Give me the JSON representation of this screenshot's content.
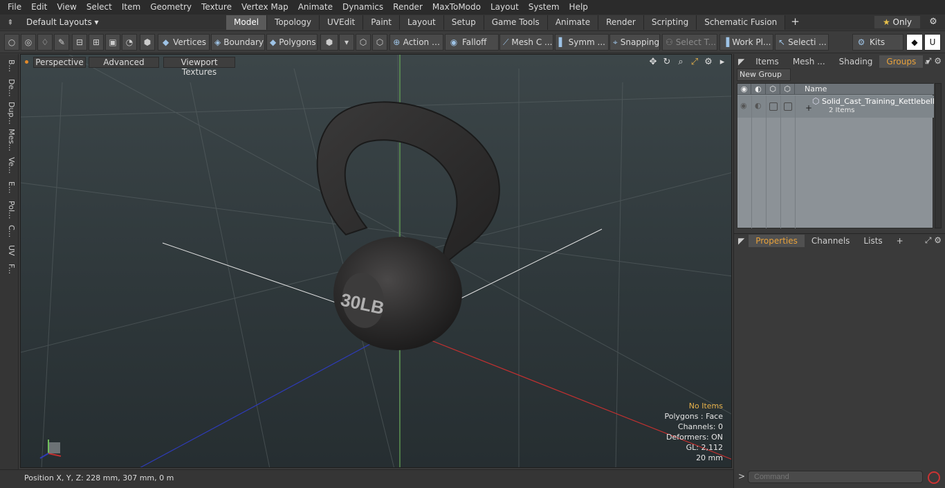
{
  "menubar": [
    "File",
    "Edit",
    "View",
    "Select",
    "Item",
    "Geometry",
    "Texture",
    "Vertex Map",
    "Animate",
    "Dynamics",
    "Render",
    "MaxToModo",
    "Layout",
    "System",
    "Help"
  ],
  "layoutbar": {
    "preset": "Default Layouts ▾",
    "tabs": [
      "Model",
      "Topology",
      "UVEdit",
      "Paint",
      "Layout",
      "Setup",
      "Game Tools",
      "Animate",
      "Render",
      "Scripting",
      "Schematic Fusion"
    ],
    "active_tab": "Model",
    "only_label": "Only"
  },
  "toolbar": {
    "vertices": "Vertices",
    "boundary": "Boundary",
    "polygons": "Polygons",
    "action": "Action",
    "falloff": "Falloff",
    "mesh": "Mesh C ...",
    "symm": "Symm ...",
    "snapping": "Snapping",
    "select_t": "Select T...",
    "work_pl": "Work Pl...",
    "selecti": "Selecti ...",
    "kits": "Kits"
  },
  "leftstrip": [
    "B...",
    "De...",
    "Dup...",
    "Mes...",
    "Ve...",
    "E...",
    "Pol...",
    "C...",
    "UV",
    "F..."
  ],
  "viewport": {
    "perspective": "Perspective",
    "advanced": "Advanced",
    "viewport_textures": "Viewport Textures",
    "model_label": "30LB",
    "stats": {
      "no_items": "No Items",
      "polygons": "Polygons : Face",
      "channels": "Channels: 0",
      "deformers": "Deformers: ON",
      "gl": "GL: 2,112",
      "scale": "20 mm"
    }
  },
  "statusbar": {
    "position": "Position X, Y, Z:   228 mm, 307 mm, 0 m"
  },
  "groups_panel": {
    "tabs": [
      "Items",
      "Mesh ...",
      "Shading",
      "Groups"
    ],
    "active_tab": "Groups",
    "new_group": "New Group",
    "name_header": "Name",
    "item_name": "Solid_Cast_Training_Kettlebell...",
    "item_count": "2 Items"
  },
  "properties_panel": {
    "tabs": [
      "Properties",
      "Channels",
      "Lists"
    ],
    "active_tab": "Properties",
    "plus": "+"
  },
  "command": {
    "placeholder": "Command",
    "arrow": ">"
  }
}
